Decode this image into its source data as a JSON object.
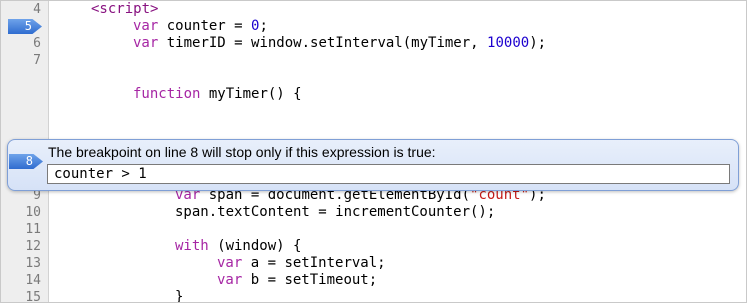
{
  "editor": {
    "lines": [
      {
        "num": "4"
      },
      {
        "num": "5",
        "breakpoint": true
      },
      {
        "num": "6"
      },
      {
        "num": "7"
      },
      {
        "num": ""
      },
      {
        "num": ""
      },
      {
        "num": ""
      },
      {
        "num": "9"
      },
      {
        "num": "10"
      },
      {
        "num": "11"
      },
      {
        "num": "12"
      },
      {
        "num": "13"
      },
      {
        "num": "14"
      },
      {
        "num": "15"
      }
    ],
    "code": {
      "l4": "<script>",
      "l5_a": "var",
      "l5_b": " counter = ",
      "l5_c": "0",
      "l5_d": ";",
      "l6_a": "var",
      "l6_b": " timerID = window.setInterval(myTimer, ",
      "l6_c": "10000",
      "l6_d": ");",
      "l8_a": "function",
      "l8_b": " myTimer() {",
      "l9_a": "var",
      "l9_b": " span = document.getElementById(",
      "l9_c": "\"count\"",
      "l9_d": ");",
      "l10": "span.textContent = incrementCounter();",
      "l12_a": "with",
      "l12_b": " (window) {",
      "l13_a": "var",
      "l13_b": " a = setInterval;",
      "l14_a": "var",
      "l14_b": " b = setTimeout;",
      "l15": "}"
    }
  },
  "breakpoint_popup": {
    "line": "8",
    "message": "The breakpoint on line 8 will stop only if this expression is true:",
    "condition": "counter > 1"
  }
}
